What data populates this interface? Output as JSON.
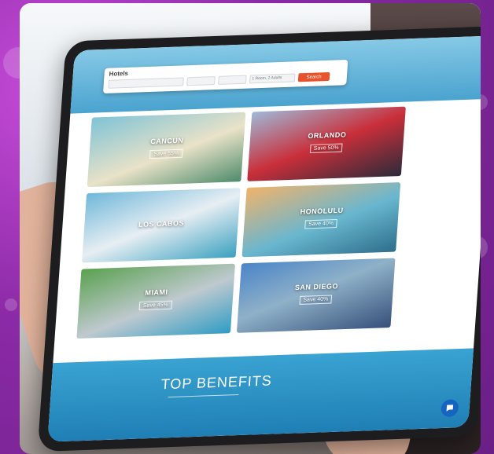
{
  "colors": {
    "background": "#9a2fb8",
    "search_button": "#e8532c",
    "chat_button": "#1565c0"
  },
  "search": {
    "title": "Hotels",
    "fields": [
      "",
      "",
      "",
      "1 Room, 2 Adults"
    ],
    "button": "Search"
  },
  "destinations": [
    {
      "city": "CANCUN",
      "save": "Save 55%"
    },
    {
      "city": "ORLANDO",
      "save": "Save 50%"
    },
    {
      "city": "LOS CABOS",
      "save": ""
    },
    {
      "city": "HONOLULU",
      "save": "Save 40%"
    },
    {
      "city": "MIAMI",
      "save": "Save 45%"
    },
    {
      "city": "SAN DIEGO",
      "save": "Save 40%"
    }
  ],
  "benefits": {
    "title": "TOP BENEFITS"
  },
  "icons": {
    "chat": "chat-bubble-icon"
  }
}
